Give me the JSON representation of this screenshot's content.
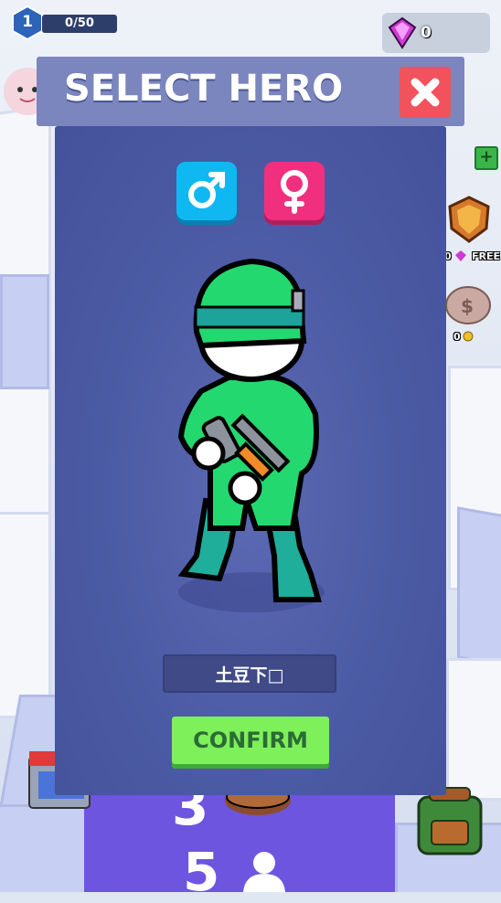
{
  "hud": {
    "level": "1",
    "xp": "0/50",
    "gems": "0",
    "reward_count": "0",
    "reward_label": "FREE",
    "piggy_count": "0"
  },
  "road": {
    "number_top": "3",
    "number_bottom": "5"
  },
  "modal": {
    "title": "SELECT HERO",
    "hero_name": "土豆下□",
    "confirm_label": "CONFIRM"
  },
  "colors": {
    "modal_bg": "#4b5aa4",
    "male_button": "#10b8f2",
    "female_button": "#f0307e",
    "close_button": "#f2525b",
    "confirm_button": "#7ef05a",
    "hero_suit": "#22d16e"
  },
  "icons": [
    "level-shield-icon",
    "gem-icon",
    "plus-icon",
    "reward-shield-icon",
    "piggy-bank-icon",
    "close-icon",
    "male-icon",
    "female-icon",
    "user-icon",
    "shop-icon",
    "backpack-icon"
  ]
}
